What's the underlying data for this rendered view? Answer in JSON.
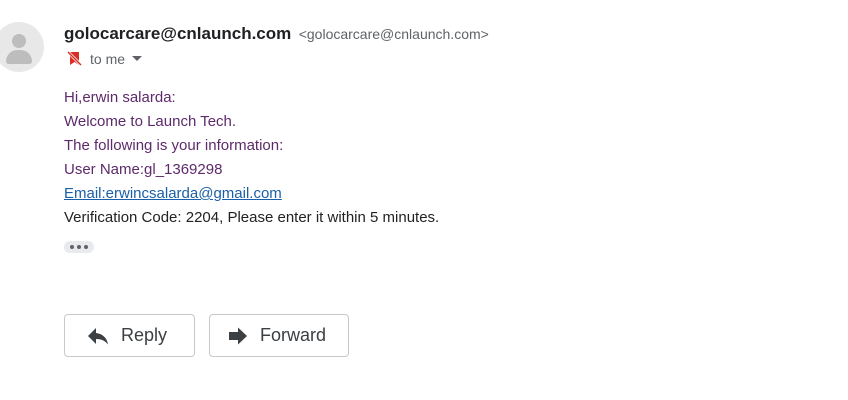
{
  "sender": {
    "name": "golocarcare@cnlaunch.com",
    "email": "<golocarcare@cnlaunch.com>"
  },
  "recipient": {
    "label": "to me"
  },
  "body": {
    "greeting": "Hi,erwin salarda:",
    "welcome": "Welcome to Launch Tech.",
    "intro": "The following is your information:",
    "username": "User Name:gl_1369298",
    "email_link": "Email:erwincsalarda@gmail.com",
    "verification": "Verification Code: 2204, Please enter it within 5 minutes."
  },
  "actions": {
    "reply_label": "Reply",
    "forward_label": "Forward"
  },
  "icons": {
    "avatar": "person-avatar-icon",
    "label": "bookmark-off-icon",
    "caret": "chevron-down-icon",
    "more": "more-horizontal-icon",
    "reply": "reply-arrow-icon",
    "forward": "forward-arrow-icon"
  },
  "colors": {
    "body_purple": "#5d2a6b",
    "link_blue": "#1a5fa8",
    "icon_red": "#d93025"
  }
}
